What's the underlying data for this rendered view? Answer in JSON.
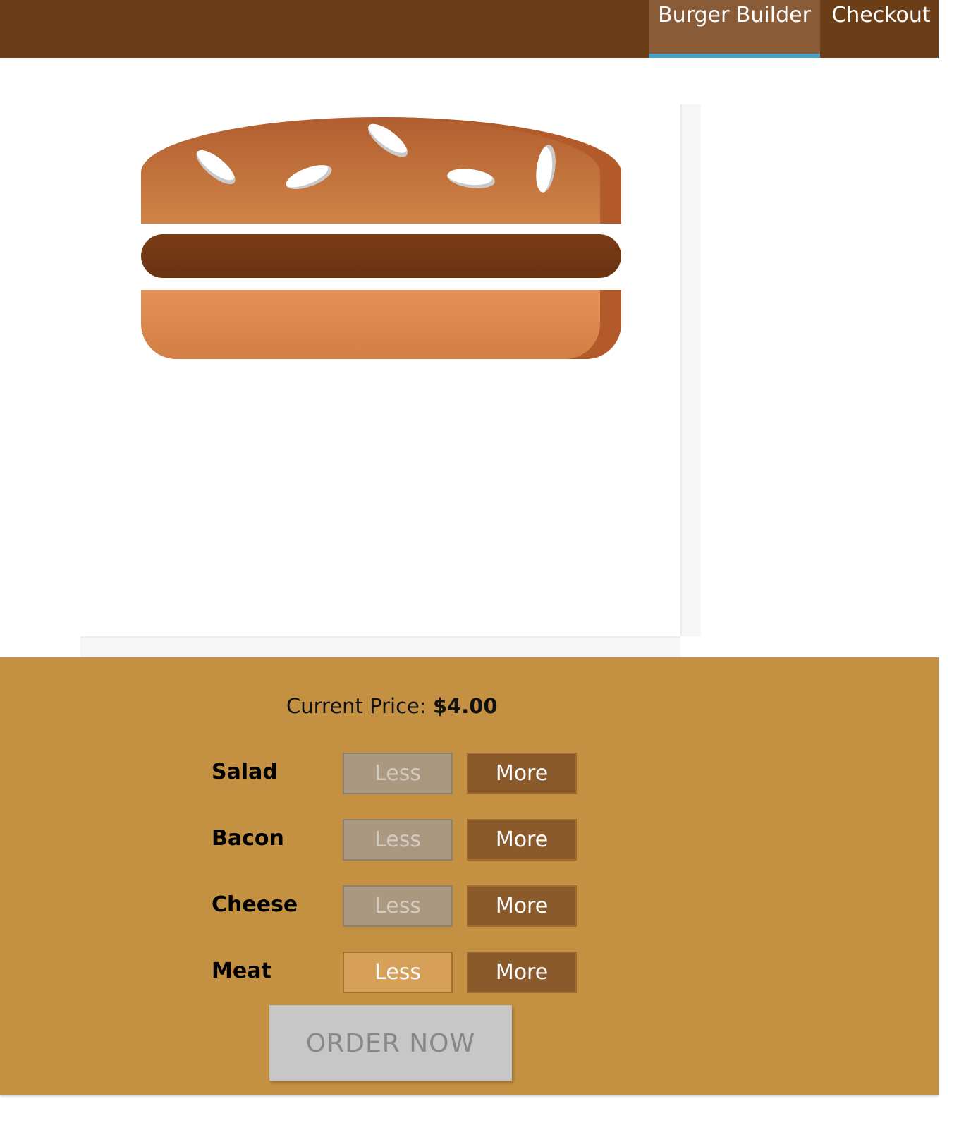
{
  "toolbar": {
    "nav": [
      {
        "label": "Burger Builder",
        "active": true
      },
      {
        "label": "Checkout",
        "active": false
      }
    ],
    "colors": {
      "background": "#6b3e18",
      "active_item": "#8a5b37",
      "active_indicator": "#4aa0c8"
    }
  },
  "burger": {
    "ingredients": [
      "bread-top",
      "meat",
      "bread-bottom"
    ]
  },
  "build_controls": {
    "price_label": "Current Price:",
    "price_value": "$4.00",
    "controls": [
      {
        "label": "Salad",
        "less": "Less",
        "more": "More",
        "less_disabled": true
      },
      {
        "label": "Bacon",
        "less": "Less",
        "more": "More",
        "less_disabled": true
      },
      {
        "label": "Cheese",
        "less": "Less",
        "more": "More",
        "less_disabled": true
      },
      {
        "label": "Meat",
        "less": "Less",
        "more": "More",
        "less_disabled": false
      }
    ],
    "order_button": "ORDER NOW",
    "order_disabled": true,
    "colors": {
      "panel": "#c49143",
      "more_button": "#8b5a2b"
    }
  }
}
